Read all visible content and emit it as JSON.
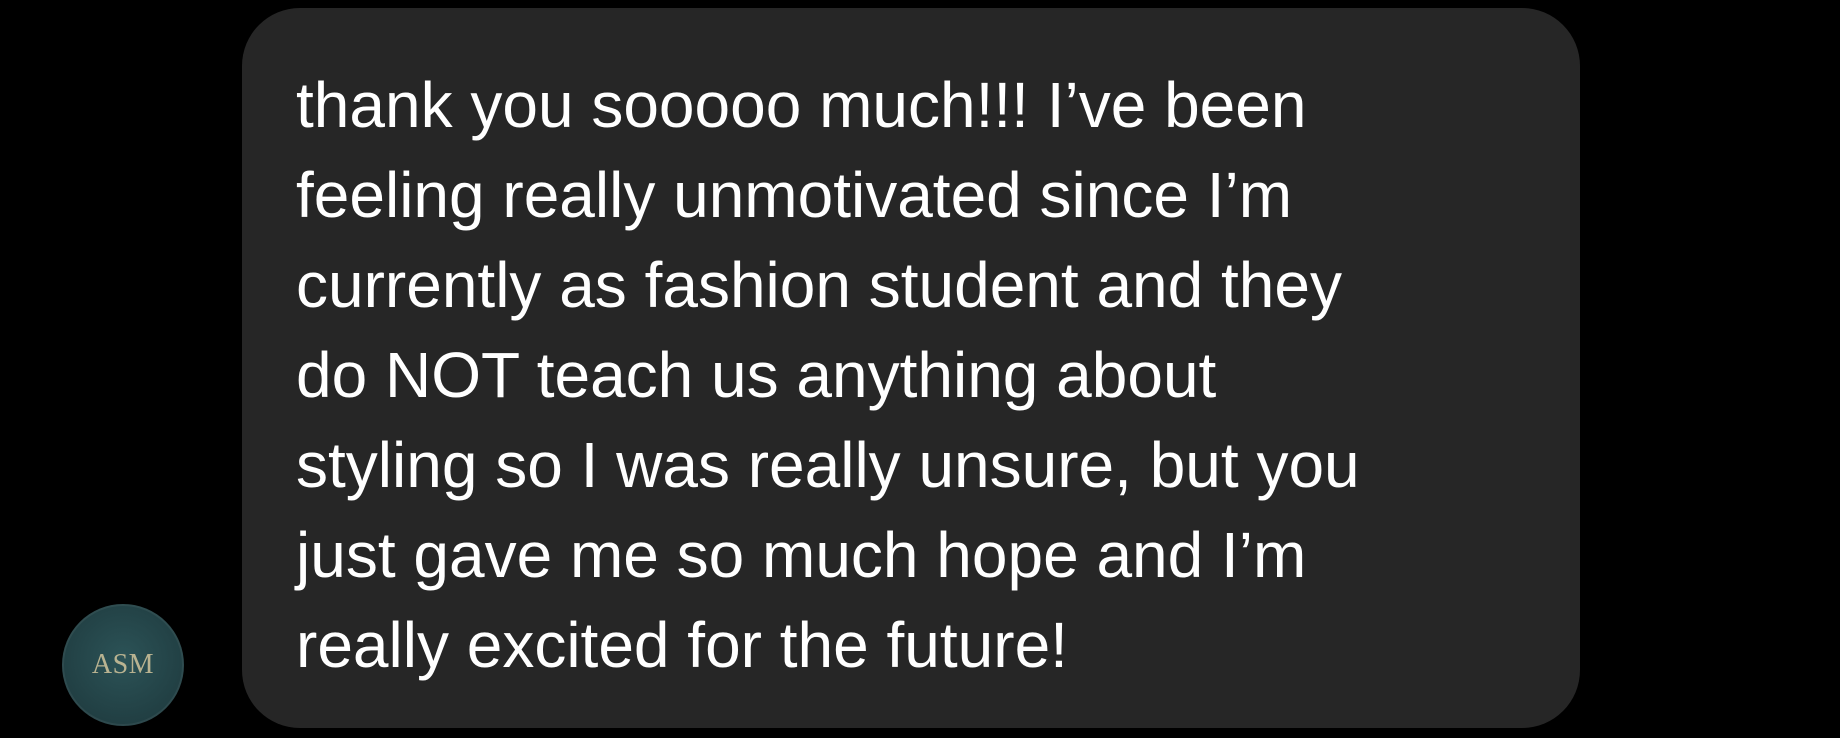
{
  "avatar": {
    "initials": "ASM"
  },
  "message": {
    "text": "thank you sooooo much!!! I’ve been\nfeeling really unmotivated since I’m\ncurrently as fashion student and they\ndo NOT teach us anything about\nstyling so I was really unsure, but you\njust gave me so much hope and I’m\nreally excited for the future!"
  },
  "colors": {
    "background": "#000000",
    "bubble": "#262626",
    "text": "#ffffff",
    "avatar_bg": "#213f43",
    "avatar_text": "#b9b391"
  }
}
